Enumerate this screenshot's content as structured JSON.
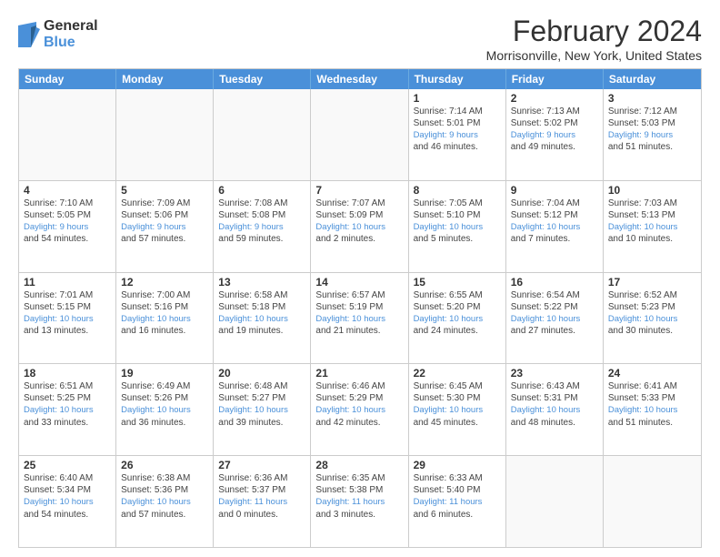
{
  "logo": {
    "general": "General",
    "blue": "Blue"
  },
  "header": {
    "month": "February 2024",
    "location": "Morrisonville, New York, United States"
  },
  "days_of_week": [
    "Sunday",
    "Monday",
    "Tuesday",
    "Wednesday",
    "Thursday",
    "Friday",
    "Saturday"
  ],
  "weeks": [
    [
      {
        "day": "",
        "info": "",
        "empty": true
      },
      {
        "day": "",
        "info": "",
        "empty": true
      },
      {
        "day": "",
        "info": "",
        "empty": true
      },
      {
        "day": "",
        "info": "",
        "empty": true
      },
      {
        "day": "1",
        "info": "Sunrise: 7:14 AM\nSunset: 5:01 PM\nDaylight: 9 hours\nand 46 minutes."
      },
      {
        "day": "2",
        "info": "Sunrise: 7:13 AM\nSunset: 5:02 PM\nDaylight: 9 hours\nand 49 minutes."
      },
      {
        "day": "3",
        "info": "Sunrise: 7:12 AM\nSunset: 5:03 PM\nDaylight: 9 hours\nand 51 minutes."
      }
    ],
    [
      {
        "day": "4",
        "info": "Sunrise: 7:10 AM\nSunset: 5:05 PM\nDaylight: 9 hours\nand 54 minutes."
      },
      {
        "day": "5",
        "info": "Sunrise: 7:09 AM\nSunset: 5:06 PM\nDaylight: 9 hours\nand 57 minutes."
      },
      {
        "day": "6",
        "info": "Sunrise: 7:08 AM\nSunset: 5:08 PM\nDaylight: 9 hours\nand 59 minutes."
      },
      {
        "day": "7",
        "info": "Sunrise: 7:07 AM\nSunset: 5:09 PM\nDaylight: 10 hours\nand 2 minutes."
      },
      {
        "day": "8",
        "info": "Sunrise: 7:05 AM\nSunset: 5:10 PM\nDaylight: 10 hours\nand 5 minutes."
      },
      {
        "day": "9",
        "info": "Sunrise: 7:04 AM\nSunset: 5:12 PM\nDaylight: 10 hours\nand 7 minutes."
      },
      {
        "day": "10",
        "info": "Sunrise: 7:03 AM\nSunset: 5:13 PM\nDaylight: 10 hours\nand 10 minutes."
      }
    ],
    [
      {
        "day": "11",
        "info": "Sunrise: 7:01 AM\nSunset: 5:15 PM\nDaylight: 10 hours\nand 13 minutes."
      },
      {
        "day": "12",
        "info": "Sunrise: 7:00 AM\nSunset: 5:16 PM\nDaylight: 10 hours\nand 16 minutes."
      },
      {
        "day": "13",
        "info": "Sunrise: 6:58 AM\nSunset: 5:18 PM\nDaylight: 10 hours\nand 19 minutes."
      },
      {
        "day": "14",
        "info": "Sunrise: 6:57 AM\nSunset: 5:19 PM\nDaylight: 10 hours\nand 21 minutes."
      },
      {
        "day": "15",
        "info": "Sunrise: 6:55 AM\nSunset: 5:20 PM\nDaylight: 10 hours\nand 24 minutes."
      },
      {
        "day": "16",
        "info": "Sunrise: 6:54 AM\nSunset: 5:22 PM\nDaylight: 10 hours\nand 27 minutes."
      },
      {
        "day": "17",
        "info": "Sunrise: 6:52 AM\nSunset: 5:23 PM\nDaylight: 10 hours\nand 30 minutes."
      }
    ],
    [
      {
        "day": "18",
        "info": "Sunrise: 6:51 AM\nSunset: 5:25 PM\nDaylight: 10 hours\nand 33 minutes."
      },
      {
        "day": "19",
        "info": "Sunrise: 6:49 AM\nSunset: 5:26 PM\nDaylight: 10 hours\nand 36 minutes."
      },
      {
        "day": "20",
        "info": "Sunrise: 6:48 AM\nSunset: 5:27 PM\nDaylight: 10 hours\nand 39 minutes."
      },
      {
        "day": "21",
        "info": "Sunrise: 6:46 AM\nSunset: 5:29 PM\nDaylight: 10 hours\nand 42 minutes."
      },
      {
        "day": "22",
        "info": "Sunrise: 6:45 AM\nSunset: 5:30 PM\nDaylight: 10 hours\nand 45 minutes."
      },
      {
        "day": "23",
        "info": "Sunrise: 6:43 AM\nSunset: 5:31 PM\nDaylight: 10 hours\nand 48 minutes."
      },
      {
        "day": "24",
        "info": "Sunrise: 6:41 AM\nSunset: 5:33 PM\nDaylight: 10 hours\nand 51 minutes."
      }
    ],
    [
      {
        "day": "25",
        "info": "Sunrise: 6:40 AM\nSunset: 5:34 PM\nDaylight: 10 hours\nand 54 minutes."
      },
      {
        "day": "26",
        "info": "Sunrise: 6:38 AM\nSunset: 5:36 PM\nDaylight: 10 hours\nand 57 minutes."
      },
      {
        "day": "27",
        "info": "Sunrise: 6:36 AM\nSunset: 5:37 PM\nDaylight: 11 hours\nand 0 minutes."
      },
      {
        "day": "28",
        "info": "Sunrise: 6:35 AM\nSunset: 5:38 PM\nDaylight: 11 hours\nand 3 minutes."
      },
      {
        "day": "29",
        "info": "Sunrise: 6:33 AM\nSunset: 5:40 PM\nDaylight: 11 hours\nand 6 minutes."
      },
      {
        "day": "",
        "info": "",
        "empty": true
      },
      {
        "day": "",
        "info": "",
        "empty": true
      }
    ]
  ]
}
